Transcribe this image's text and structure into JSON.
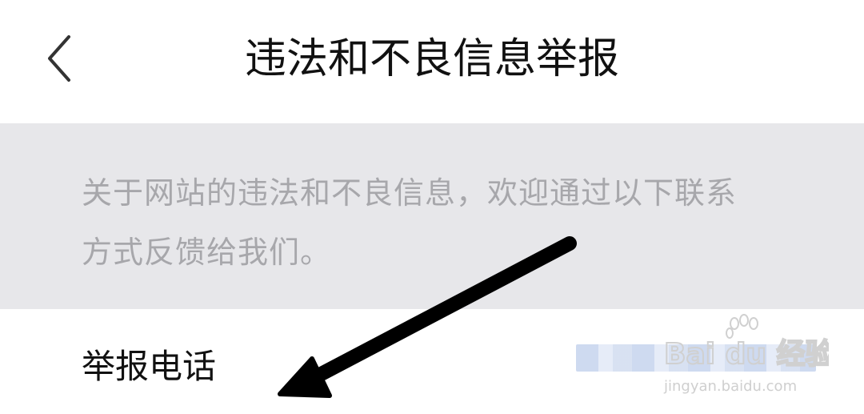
{
  "header": {
    "back_icon": "chevron-left-icon",
    "title": "违法和不良信息举报"
  },
  "notice": {
    "line1": "关于网站的违法和不良信息，欢迎通过以下联系",
    "line2": "方式反馈给我们。"
  },
  "report_phone": {
    "label": "举报电话",
    "value_state": "blurred"
  },
  "annotation": {
    "arrow_icon": "arrow-down-left-icon",
    "color": "#000000"
  },
  "watermark": {
    "brand": "Bai du 经验",
    "url": "jingyan.baidu.com"
  },
  "colors": {
    "background": "#ffffff",
    "notice_bg": "#e7e7ea",
    "notice_text": "#a7a7ab",
    "primary_text": "#111111"
  }
}
